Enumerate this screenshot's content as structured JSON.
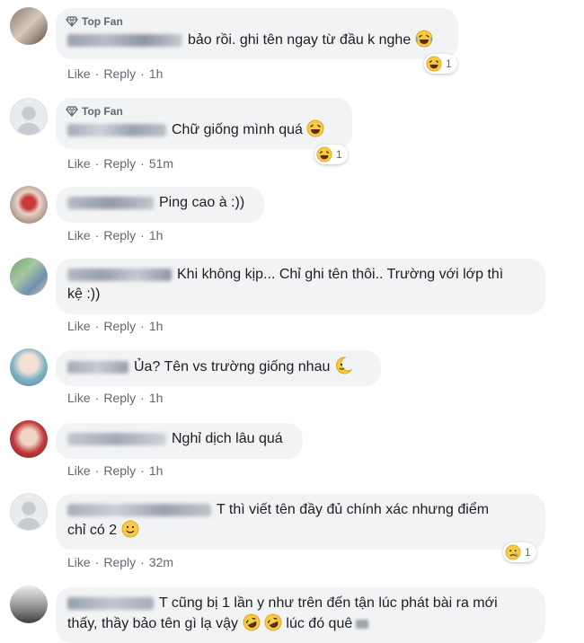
{
  "badge_label": "Top Fan",
  "action_like": "Like",
  "action_reply": "Reply",
  "action_sep": "·",
  "comments": [
    {
      "top_fan": true,
      "text": "bảo rồi. ghi tên ngay từ đầu k nghe",
      "time": "1h",
      "reactions": "1",
      "reaction_icon": "laughing-emoji"
    },
    {
      "top_fan": true,
      "text": "Chữ giống mình quá",
      "time": "51m",
      "reactions": "1",
      "reaction_icon": "laughing-emoji"
    },
    {
      "top_fan": false,
      "text": "Ping cao à :))",
      "time": "1h"
    },
    {
      "top_fan": false,
      "text_line1": "Khi không kịp... Chỉ ghi tên thôi.. Trường với lớp thì",
      "text_line2": "kệ :))",
      "time": "1h"
    },
    {
      "top_fan": false,
      "text": "Ủa? Tên vs trường giống nhau",
      "time": "1h",
      "emoji": "crescent-moon-face"
    },
    {
      "top_fan": false,
      "text": "Nghỉ dịch lâu quá",
      "time": "1h"
    },
    {
      "top_fan": false,
      "text_line1": "T thì viết tên đầy đủ chính xác nhưng điểm",
      "text_line2": "chỉ có 2",
      "time": "32m",
      "reactions": "1",
      "reaction_icon": "sad-emoji"
    },
    {
      "top_fan": false,
      "text_line1": "T cũng bị 1 lần y như trên đến tận lúc phát bài ra mới",
      "text_line2a": "thấy, thầy bảo tên gì lạ vậy",
      "text_line2b": "lúc đó quê"
    }
  ]
}
